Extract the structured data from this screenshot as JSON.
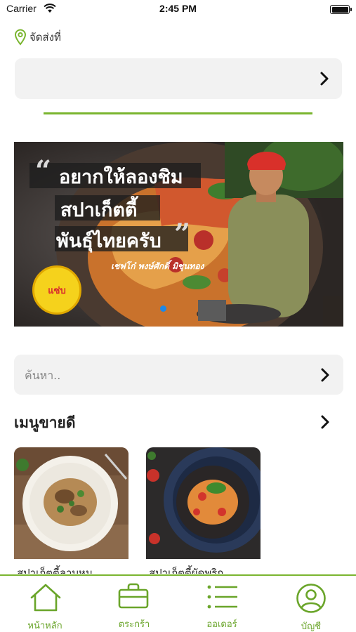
{
  "status_bar": {
    "carrier": "Carrier",
    "time": "2:45 PM"
  },
  "delivery": {
    "label": "จัดส่งที่",
    "address": ""
  },
  "banner": {
    "lines": [
      "อยากให้ลองชิม",
      "สปาเก็ตตี้",
      "พันธุ์ไทยครับ"
    ],
    "caption": "เชฟโก๋ พงษ์ศักดิ์ มิชุนทอง",
    "logo_text": "แซ่บ"
  },
  "search": {
    "placeholder": "ค้นหา..",
    "value": ""
  },
  "bestseller": {
    "title": "เมนูขายดี",
    "items": [
      {
        "name": "สปาเก็ตตี้ลาบหมู"
      },
      {
        "name": "สปาเก็ตตี้ผัดพริก"
      }
    ]
  },
  "tabs": [
    {
      "label": "หน้าหลัก",
      "icon": "home-icon"
    },
    {
      "label": "ตระกร้า",
      "icon": "basket-icon"
    },
    {
      "label": "ออเดอร์",
      "icon": "list-icon"
    },
    {
      "label": "บัญชี",
      "icon": "account-icon"
    }
  ],
  "colors": {
    "accent": "#7ab52f",
    "tab_label": "#6aa52a",
    "field_bg": "#f2f2f2"
  }
}
